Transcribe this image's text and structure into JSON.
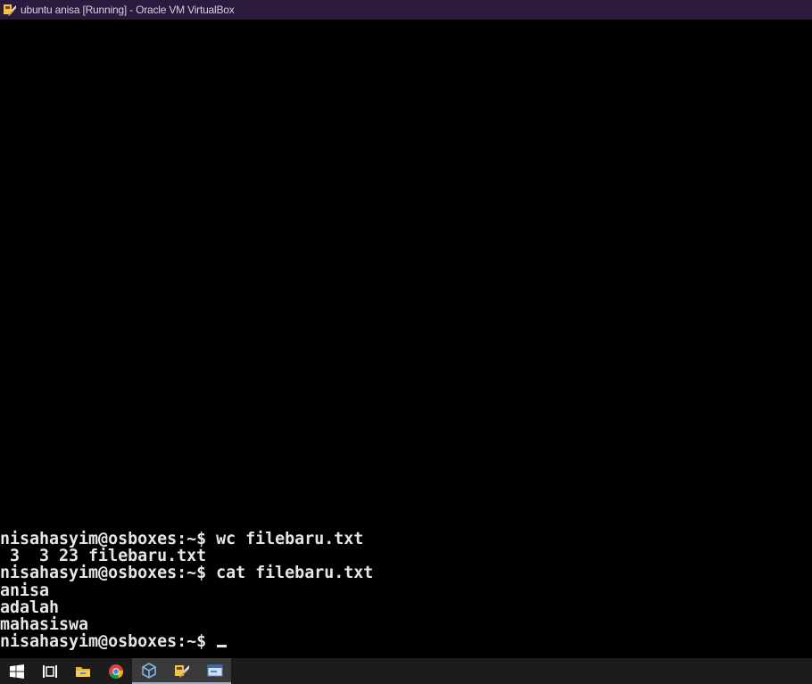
{
  "window": {
    "title": "ubuntu anisa [Running] - Oracle VM VirtualBox",
    "icon": "virtualbox-vm-icon"
  },
  "console": {
    "lines": [
      "nisahasyim@osboxes:~$ wc filebaru.txt",
      " 3  3 23 filebaru.txt",
      "nisahasyim@osboxes:~$ cat filebaru.txt",
      "anisa",
      "adalah",
      "mahasiswa",
      "nisahasyim@osboxes:~$ "
    ],
    "cursor": "_"
  },
  "taskbar": {
    "items": [
      {
        "icon": "windows-start-icon",
        "active": false
      },
      {
        "icon": "task-view-icon",
        "active": false
      },
      {
        "icon": "file-explorer-icon",
        "active": false
      },
      {
        "icon": "chrome-icon",
        "active": false
      },
      {
        "icon": "virtualbox-manager-icon",
        "active": true
      },
      {
        "icon": "virtualbox-vm-icon",
        "active": true
      },
      {
        "icon": "remote-display-icon",
        "active": true
      }
    ]
  },
  "colors": {
    "titlebar": "#2b1a3d",
    "console_bg": "#000000",
    "console_fg": "#e6e6e6",
    "taskbar": "#1c1c1c"
  }
}
